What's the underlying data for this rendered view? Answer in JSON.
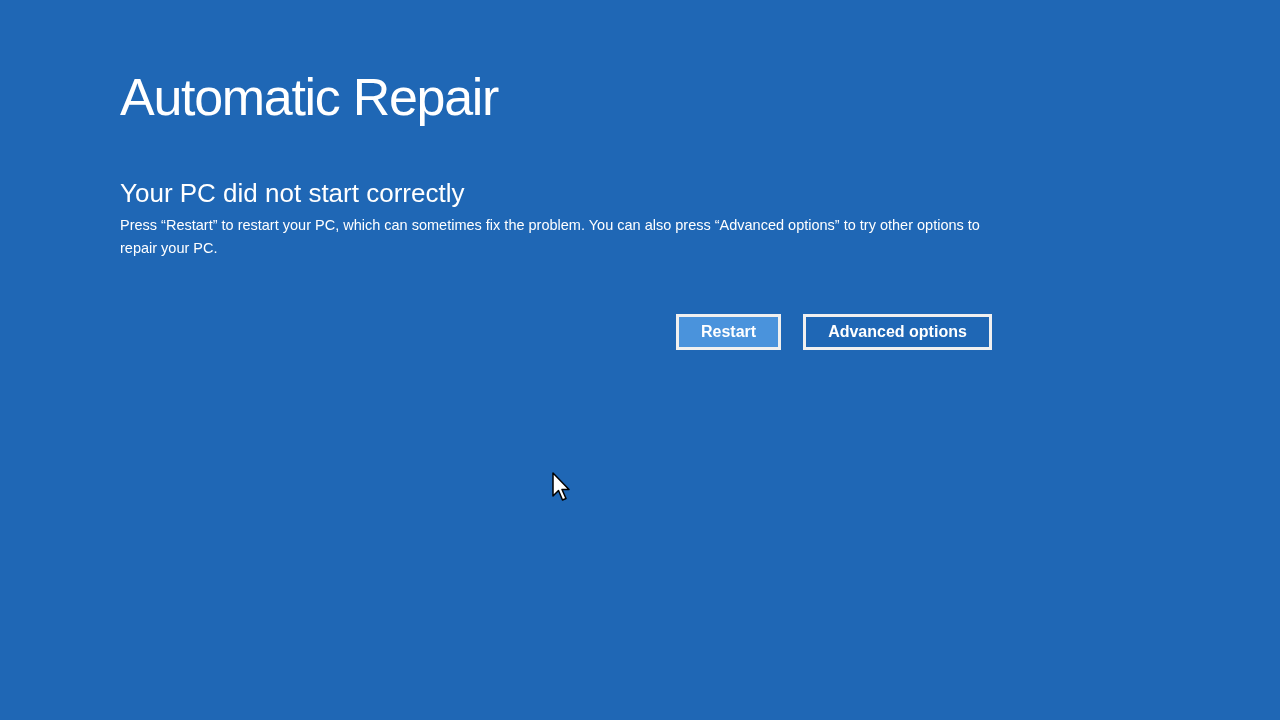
{
  "title": "Automatic Repair",
  "subtitle": "Your PC did not start correctly",
  "message": "Press “Restart” to restart your PC, which can sometimes fix the problem. You can also press “Advanced options” to try other options to repair your PC.",
  "buttons": [
    {
      "label": "Restart",
      "selected": true
    },
    {
      "label": "Advanced options",
      "selected": false
    }
  ]
}
